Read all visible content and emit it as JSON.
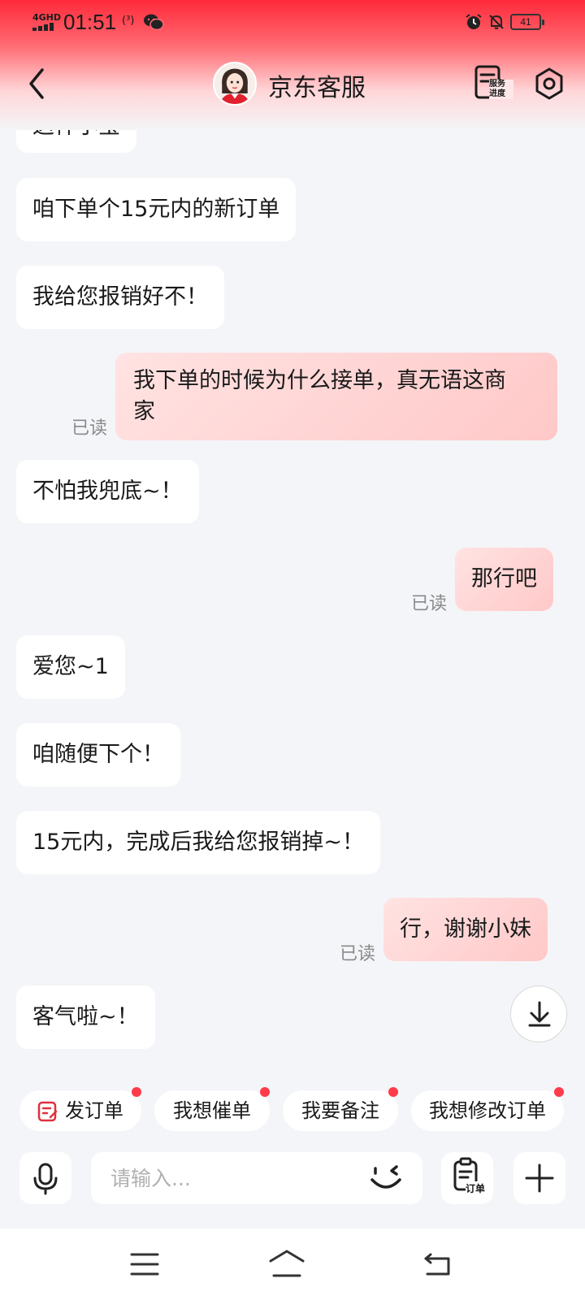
{
  "status_bar": {
    "network": "4GHD",
    "time": "01:51",
    "hd_call": "(³)",
    "battery": "41"
  },
  "header": {
    "title": "京东客服",
    "progress_label_line1": "服务",
    "progress_label_line2": "进度"
  },
  "messages": [
    {
      "side": "in",
      "text": "这样小宝"
    },
    {
      "side": "in",
      "text": "咱下单个15元内的新订单"
    },
    {
      "side": "in",
      "text": "我给您报销好不！"
    },
    {
      "side": "out",
      "text_line1": "我下单的时候为什么接单，真无语这商",
      "text_line2": "家",
      "read": "已读"
    },
    {
      "side": "in",
      "text": "不怕我兜底~！"
    },
    {
      "side": "out",
      "text": "那行吧",
      "read": "已读"
    },
    {
      "side": "in",
      "text": "爱您~1"
    },
    {
      "side": "in",
      "text": "咱随便下个！"
    },
    {
      "side": "in",
      "text": "15元内，完成后我给您报销掉~！"
    },
    {
      "side": "out",
      "text": "行，谢谢小妹",
      "read": "已读"
    },
    {
      "side": "in",
      "text": "客气啦~！"
    }
  ],
  "quick_actions": [
    {
      "label": "发订单",
      "has_icon": true
    },
    {
      "label": "我想催单"
    },
    {
      "label": "我要备注"
    },
    {
      "label": "我想修改订单"
    }
  ],
  "input": {
    "placeholder": "请输入...",
    "value": "",
    "order_label": "订单"
  },
  "colors": {
    "brand_red": "#ff2a3a",
    "out_bubble": "#ffcfcf",
    "badge_dot": "#ff3b4a"
  }
}
